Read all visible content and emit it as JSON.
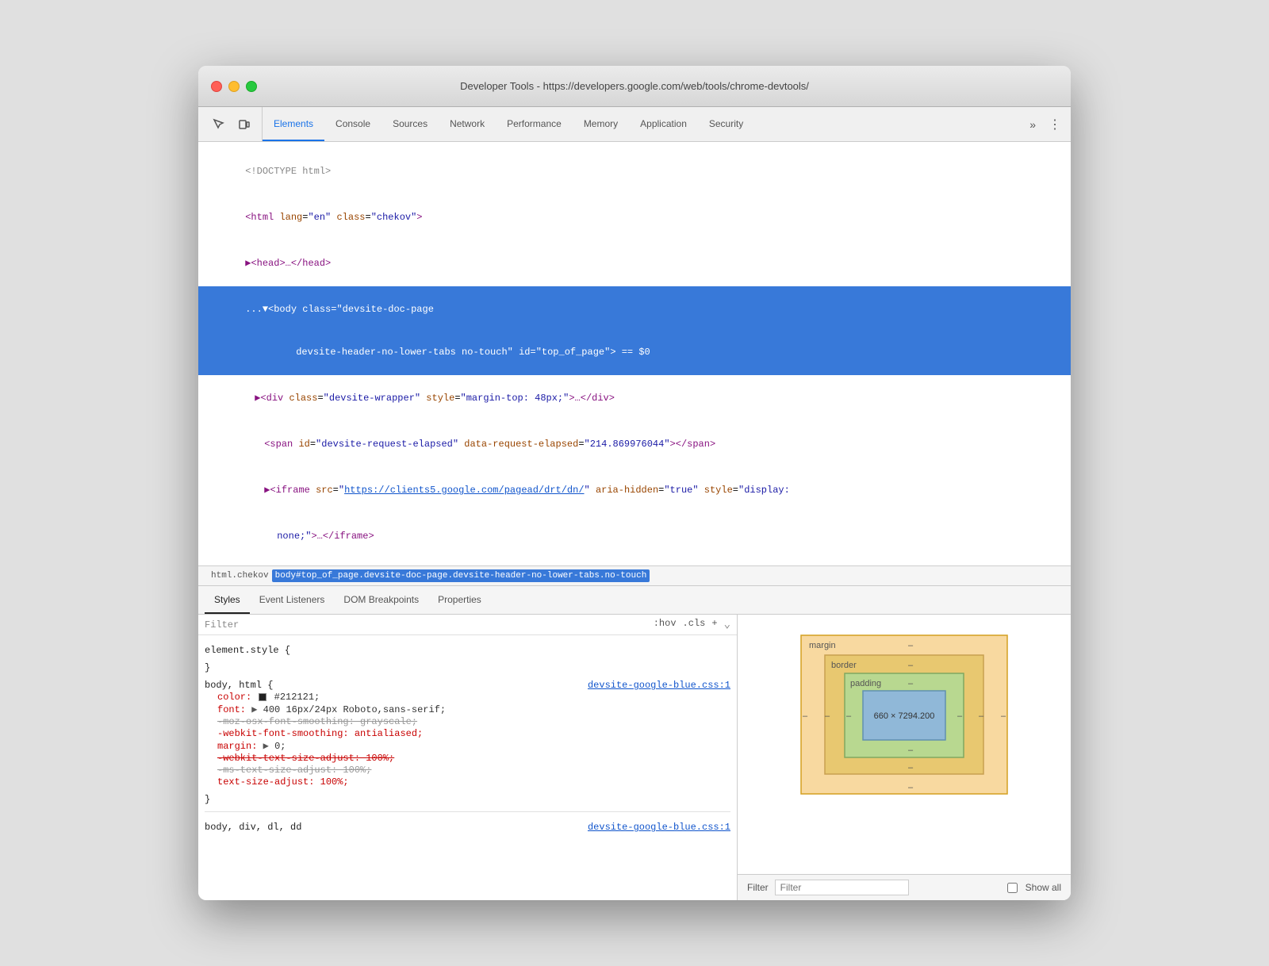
{
  "window": {
    "title": "Developer Tools - https://developers.google.com/web/tools/chrome-devtools/"
  },
  "toolbar": {
    "tabs": [
      {
        "id": "elements",
        "label": "Elements",
        "active": true
      },
      {
        "id": "console",
        "label": "Console",
        "active": false
      },
      {
        "id": "sources",
        "label": "Sources",
        "active": false
      },
      {
        "id": "network",
        "label": "Network",
        "active": false
      },
      {
        "id": "performance",
        "label": "Performance",
        "active": false
      },
      {
        "id": "memory",
        "label": "Memory",
        "active": false
      },
      {
        "id": "application",
        "label": "Application",
        "active": false
      },
      {
        "id": "security",
        "label": "Security",
        "active": false
      }
    ],
    "more_label": "»",
    "kebab_label": "⋮"
  },
  "dom": {
    "lines": [
      {
        "id": "line1",
        "content": "<!DOCTYPE html>",
        "selected": false
      },
      {
        "id": "line2",
        "content_html": "<span class='tag'>&lt;html</span> <span class='attr-name'>lang</span>=<span class='attr-value'>\"en\"</span> <span class='attr-name'>class</span>=<span class='attr-value'>\"chekov\"</span><span class='tag'>&gt;</span>",
        "selected": false
      },
      {
        "id": "line3",
        "content_html": "<span class='tag'>▶&lt;head&gt;…&lt;/head&gt;</span>",
        "selected": false
      },
      {
        "id": "line4",
        "content_html": "<span>...▼</span><span class='tag'>&lt;body</span> <span class='attr-name'>class</span>=<span class='attr-value'>\"devsite-doc-page</span>",
        "selected": true
      },
      {
        "id": "line4b",
        "content_html": "<span class='attr-value'>devsite-header-no-lower-tabs no-touch\"</span> <span class='attr-name'>id</span>=<span class='attr-value'>\"top_of_page\"</span>&gt; == $0",
        "selected": true
      },
      {
        "id": "line5",
        "content_html": "  <span class='tag'>▶&lt;div</span> <span class='attr-name'>class</span>=<span class='attr-value'>\"devsite-wrapper\"</span> <span class='attr-name'>style</span>=<span class='attr-value'>\"margin-top: 48px;\"</span><span class='tag'>&gt;…&lt;/div&gt;</span>",
        "selected": false
      },
      {
        "id": "line6",
        "content_html": "  <span class='tag'>&lt;span</span> <span class='attr-name'>id</span>=<span class='attr-value'>\"devsite-request-elapsed\"</span> <span class='attr-name'>data-request-elapsed</span>=<span class='attr-value'>\"214.869976044\"</span><span class='tag'>&gt;&lt;/span&gt;</span>",
        "selected": false
      },
      {
        "id": "line7",
        "content_html": "  <span class='tag'>▶&lt;iframe</span> <span class='attr-name'>src</span>=<span class='attr-value'>\"<a>https://clients5.google.com/pagead/drt/dn/</a>\"</span> <span class='attr-name'>aria-hidden</span>=<span class='attr-value'>\"true\"</span> <span class='attr-name'>style</span>=<span class='attr-value'>\"display:</span>",
        "selected": false
      },
      {
        "id": "line8",
        "content_html": "  <span class='attr-value'>none;\"</span><span class='tag'>&gt;…&lt;/iframe&gt;</span>",
        "selected": false
      }
    ]
  },
  "breadcrumb": {
    "items": [
      {
        "id": "bc1",
        "label": "html.chekov",
        "active": false
      },
      {
        "id": "bc2",
        "label": "body#top_of_page.devsite-doc-page.devsite-header-no-lower-tabs.no-touch",
        "active": true
      }
    ]
  },
  "subtabs": {
    "items": [
      {
        "id": "styles",
        "label": "Styles",
        "active": true
      },
      {
        "id": "event-listeners",
        "label": "Event Listeners",
        "active": false
      },
      {
        "id": "dom-breakpoints",
        "label": "DOM Breakpoints",
        "active": false
      },
      {
        "id": "properties",
        "label": "Properties",
        "active": false
      }
    ]
  },
  "styles": {
    "filter_placeholder": "Filter",
    "hov_label": ":hov",
    "cls_label": ".cls",
    "plus_label": "+",
    "rules": [
      {
        "selector": "element.style {",
        "close": "}",
        "properties": []
      },
      {
        "selector": "body, html {",
        "source": "devsite-google-blue.css:1",
        "close": "}",
        "properties": [
          {
            "name": "color:",
            "value": "■ #212121;",
            "strikethrough": false,
            "swatch": true
          },
          {
            "name": "font:",
            "value": "▶ 400 16px/24px Roboto,sans-serif;",
            "strikethrough": false
          },
          {
            "name": "-moz-osx-font-smoothing: grayscale;",
            "value": "",
            "strikethrough": true
          },
          {
            "name": "-webkit-font-smoothing:",
            "value": "antialiased;",
            "strikethrough": false,
            "red": true
          },
          {
            "name": "margin:",
            "value": "▶ 0;",
            "strikethrough": false
          },
          {
            "name": "-webkit-text-size-adjust: 100%;",
            "value": "",
            "strikethrough": true,
            "red_strike": true
          },
          {
            "name": "-ms-text-size-adjust: 100%;",
            "value": "",
            "strikethrough": true
          },
          {
            "name": "text-size-adjust:",
            "value": "100%;",
            "strikethrough": false,
            "red": true
          }
        ]
      }
    ],
    "bottom_rule": "body, div, dl, dd"
  },
  "box_model": {
    "margin_label": "margin",
    "margin_dash": "–",
    "border_label": "border",
    "border_dash": "–",
    "padding_label": "padding",
    "padding_dash": "–",
    "dimensions": "660 × 7294.200",
    "dashes": [
      "–",
      "–",
      "–",
      "–",
      "–",
      "–"
    ]
  },
  "filter_bottom": {
    "label": "Filter",
    "show_all_label": "Show all"
  }
}
